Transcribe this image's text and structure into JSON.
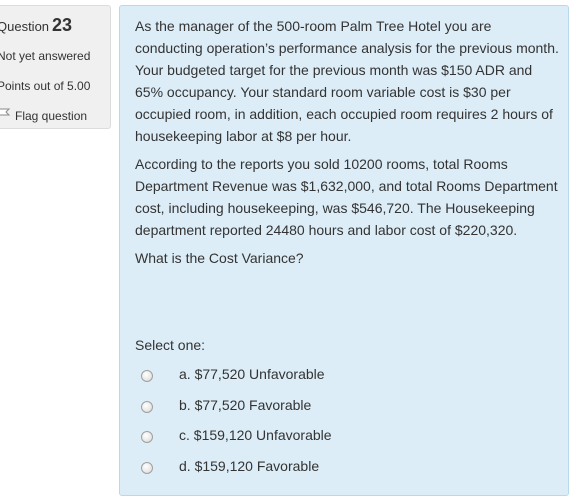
{
  "info": {
    "question_label": "Question",
    "question_number": "23",
    "state": "Not yet answered",
    "grade": "Points out of 5.00",
    "flag_label": "Flag question"
  },
  "question": {
    "paragraphs": [
      "As the manager of the 500-room Palm Tree Hotel you are conducting operation’s performance analysis for the previous month. Your budgeted target for the previous month was $150 ADR and 65% occupancy. Your standard room variable cost is $30 per occupied room, in addition, each occupied room requires 2 hours of housekeeping labor at $8 per hour.",
      "According to the reports you sold 10200 rooms, total Rooms Department Revenue was $1,632,000, and total Rooms Department cost, including housekeeping, was $546,720. The Housekeeping department reported 24480 hours and labor cost of $220,320.",
      "What is the Cost Variance?"
    ],
    "select_prompt": "Select one:",
    "answers": [
      "a. $77,520 Unfavorable",
      "b. $77,520 Favorable",
      "c. $159,120 Unfavorable",
      "d. $159,120 Favorable"
    ]
  },
  "icons": {
    "flag": "flag-icon"
  },
  "colors": {
    "panel_bg": "#f0f0f0",
    "content_bg": "#dcedf7",
    "content_border": "#b8d9ec",
    "text": "#333333"
  }
}
